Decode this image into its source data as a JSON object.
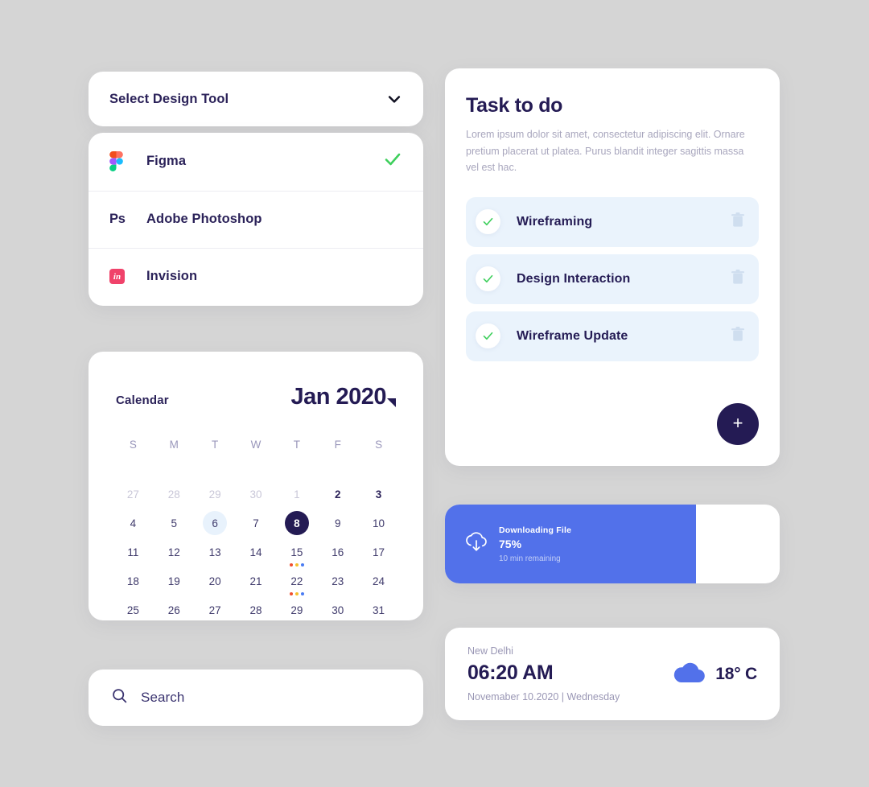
{
  "select_tool": {
    "label": "Select Design Tool",
    "chevron_icon": "chevron-down-icon"
  },
  "tools": [
    {
      "name": "Figma",
      "icon": "figma-icon",
      "selected": true,
      "check_icon": "check-icon"
    },
    {
      "name": "Adobe Photoshop",
      "icon": "photoshop-icon",
      "logo_text": "Ps",
      "selected": false
    },
    {
      "name": "Invision",
      "icon": "invision-icon",
      "logo_text": "in",
      "selected": false
    }
  ],
  "calendar": {
    "title": "Calendar",
    "month": "Jan 2020",
    "caret_icon": "caret-down-icon",
    "dow": [
      "S",
      "M",
      "T",
      "W",
      "T",
      "F",
      "S"
    ],
    "days": [
      {
        "n": "27",
        "muted": true
      },
      {
        "n": "28",
        "muted": true
      },
      {
        "n": "29",
        "muted": true
      },
      {
        "n": "30",
        "muted": true
      },
      {
        "n": "1",
        "muted": true
      },
      {
        "n": "2",
        "bold": true
      },
      {
        "n": "3",
        "bold": true
      },
      {
        "n": "4"
      },
      {
        "n": "5"
      },
      {
        "n": "6",
        "soft": true
      },
      {
        "n": "7"
      },
      {
        "n": "8",
        "active": true
      },
      {
        "n": "9"
      },
      {
        "n": "10"
      },
      {
        "n": "11"
      },
      {
        "n": "12"
      },
      {
        "n": "13"
      },
      {
        "n": "14"
      },
      {
        "n": "15",
        "dots": [
          "#f0502f",
          "#f5c12e",
          "#4b7cf3"
        ]
      },
      {
        "n": "16"
      },
      {
        "n": "17"
      },
      {
        "n": "18"
      },
      {
        "n": "19"
      },
      {
        "n": "20"
      },
      {
        "n": "21"
      },
      {
        "n": "22",
        "dots": [
          "#f0502f",
          "#f5c12e",
          "#4b7cf3"
        ]
      },
      {
        "n": "23"
      },
      {
        "n": "24"
      },
      {
        "n": "25"
      },
      {
        "n": "26"
      },
      {
        "n": "27"
      },
      {
        "n": "28"
      },
      {
        "n": "29"
      },
      {
        "n": "30"
      },
      {
        "n": "31"
      }
    ]
  },
  "search": {
    "placeholder": "Search",
    "value": "Search",
    "icon": "search-icon"
  },
  "task": {
    "title": "Task to do",
    "description": "Lorem ipsum dolor sit amet, consectetur adipiscing elit. Ornare pretium placerat ut platea. Purus blandit integer sagittis massa vel est hac.",
    "items": [
      {
        "label": "Wireframing",
        "done": true,
        "check_icon": "check-icon",
        "delete_icon": "trash-icon"
      },
      {
        "label": "Design Interaction",
        "done": true,
        "check_icon": "check-icon",
        "delete_icon": "trash-icon"
      },
      {
        "label": "Wireframe Update",
        "done": true,
        "check_icon": "check-icon",
        "delete_icon": "trash-icon"
      }
    ],
    "add_button_label": "+",
    "add_button_icon": "plus-icon"
  },
  "download": {
    "title": "Downloading File",
    "percent_label": "75%",
    "percent_value": 75,
    "remaining": "10 min remaining",
    "icon": "cloud-download-icon",
    "fill_color": "#5271ea"
  },
  "weather": {
    "city": "New Delhi",
    "time": "06:20 AM",
    "date": "Novemaber 10.2020 | Wednesday",
    "temperature": "18° C",
    "icon": "cloud-icon",
    "icon_color": "#5271ea"
  },
  "theme": {
    "background": "#d5d5d5",
    "card": "#ffffff",
    "primary": "#241b54",
    "accent_blue": "#5271ea",
    "accent_green": "#3ecf5c",
    "task_row_bg": "#eaf3fc"
  }
}
